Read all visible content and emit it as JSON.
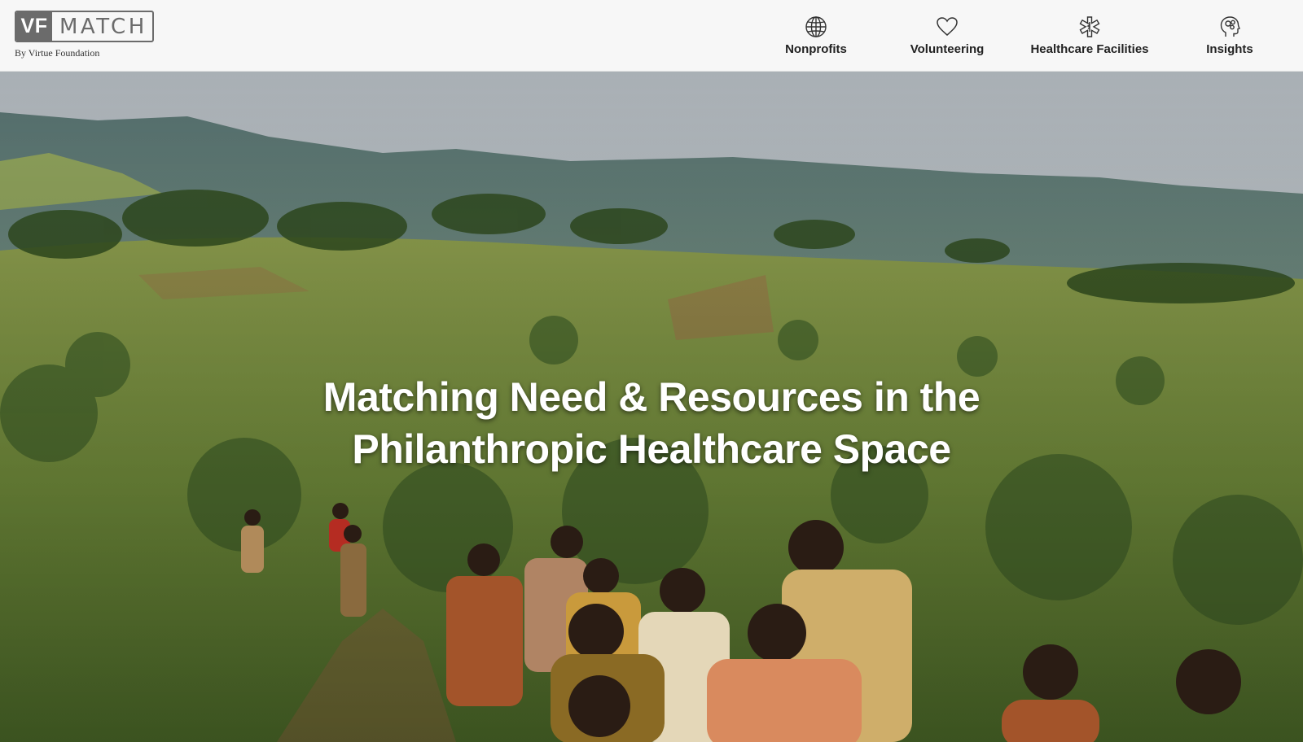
{
  "brand": {
    "logo_vf": "VF",
    "logo_match": "MATCH",
    "subtitle": "By Virtue Foundation"
  },
  "nav": {
    "items": [
      {
        "label": "Nonprofits",
        "icon": "globe-icon"
      },
      {
        "label": "Volunteering",
        "icon": "heart-icon"
      },
      {
        "label": "Healthcare Facilities",
        "icon": "medical-cross-icon"
      },
      {
        "label": "Insights",
        "icon": "head-insights-icon"
      }
    ]
  },
  "hero": {
    "headline_line1": "Matching Need & Resources in the",
    "headline_line2": "Philanthropic Healthcare Space",
    "image": "landscape-photo-children-walking"
  },
  "colors": {
    "nav_bg": "#f7f7f7",
    "logo_gray": "#6b6b6b",
    "headline": "#ffffff"
  }
}
